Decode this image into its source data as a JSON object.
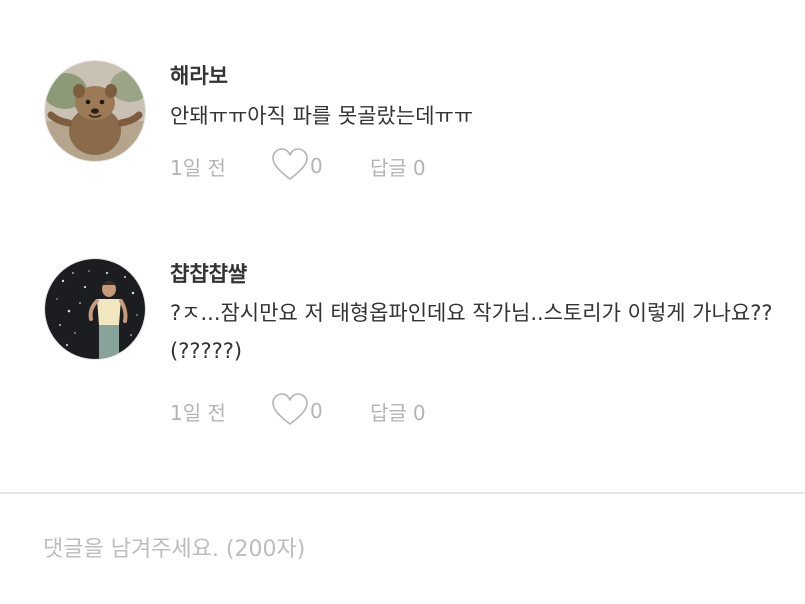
{
  "comments": [
    {
      "author": "해라보",
      "text": "안돼ㅠㅠ아직 파를 못골랐는데ㅠㅠ",
      "time": "1일 전",
      "likes": "0",
      "reply_label": "답글",
      "replies": "0",
      "avatar_icon": "quokka-photo"
    },
    {
      "author": "챱챱챱쌸",
      "text": "?ㅈ...잠시만요 저 태형옵파인데요 작가님..스토리가 이렇게 가나요??(?????)",
      "time": "1일 전",
      "likes": "0",
      "reply_label": "답글",
      "replies": "0",
      "avatar_icon": "person-photo"
    }
  ],
  "input": {
    "placeholder": "댓글을 남겨주세요. (200자)"
  },
  "colors": {
    "meta_text": "#b4b4b4",
    "divider": "#e4e4e4",
    "body_text": "#333333"
  }
}
